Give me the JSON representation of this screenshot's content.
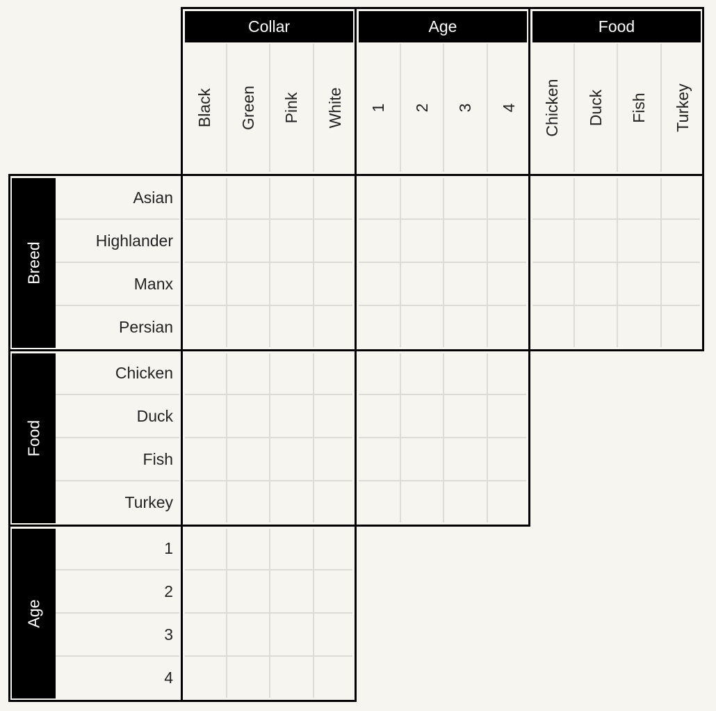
{
  "puzzle": {
    "column_groups": [
      {
        "label": "Collar",
        "items": [
          "Black",
          "Green",
          "Pink",
          "White"
        ]
      },
      {
        "label": "Age",
        "items": [
          "1",
          "2",
          "3",
          "4"
        ]
      },
      {
        "label": "Food",
        "items": [
          "Chicken",
          "Duck",
          "Fish",
          "Turkey"
        ]
      }
    ],
    "row_groups": [
      {
        "label": "Breed",
        "items": [
          "Asian",
          "Highlander",
          "Manx",
          "Persian"
        ]
      },
      {
        "label": "Food",
        "items": [
          "Chicken",
          "Duck",
          "Fish",
          "Turkey"
        ]
      },
      {
        "label": "Age",
        "items": [
          "1",
          "2",
          "3",
          "4"
        ]
      }
    ],
    "colors": {
      "background": "#f6f5ef",
      "border": "#000000",
      "header_bg": "#000000",
      "header_text": "#ffffff",
      "grid_line": "#dcdbd6",
      "text": "#222222"
    }
  }
}
